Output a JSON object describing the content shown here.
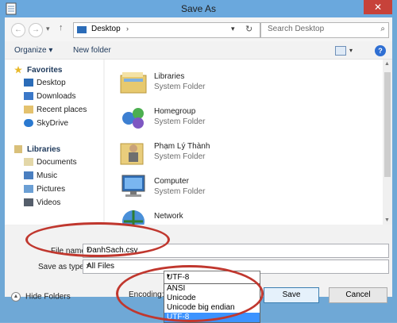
{
  "window": {
    "title": "Save As",
    "close_glyph": "✕"
  },
  "nav": {
    "back_glyph": "←",
    "forward_glyph": "→",
    "recent_glyph": "▾",
    "up_glyph": "↑",
    "address": "Desktop",
    "address_chevron": "›",
    "address_dropdown": "▾",
    "refresh_glyph": "↻",
    "search_placeholder": "Search Desktop",
    "search_glyph": "⌕"
  },
  "toolbar": {
    "organize": "Organize ▾",
    "new_folder": "New folder",
    "view_dropdown": "▾",
    "help": "?"
  },
  "sidebar": {
    "favorites": "Favorites",
    "favorites_items": [
      "Desktop",
      "Downloads",
      "Recent places",
      "SkyDrive"
    ],
    "libraries": "Libraries",
    "libraries_items": [
      "Documents",
      "Music",
      "Pictures",
      "Videos"
    ]
  },
  "files": [
    {
      "name": "Libraries",
      "type": "System Folder",
      "icon": "libraries-icon"
    },
    {
      "name": "Homegroup",
      "type": "System Folder",
      "icon": "homegroup-icon"
    },
    {
      "name": "Phạm Lý Thành",
      "type": "System Folder",
      "icon": "user-folder-icon"
    },
    {
      "name": "Computer",
      "type": "System Folder",
      "icon": "computer-icon"
    },
    {
      "name": "Network",
      "type": "",
      "icon": "network-icon"
    }
  ],
  "form": {
    "file_name_label": "File name:",
    "file_name_value": "DanhSach.csv",
    "save_type_label": "Save as type:",
    "save_type_value": "All Files",
    "encoding_label": "Encoding:",
    "encoding_value": "UTF-8",
    "encoding_options": [
      "ANSI",
      "Unicode",
      "Unicode big endian",
      "UTF-8"
    ],
    "hide_folders": "Hide Folders",
    "save": "Save",
    "cancel": "Cancel"
  },
  "colors": {
    "highlight": "#c0372e",
    "selected": "#3c93ff",
    "titlebar": "#6aa8dd"
  }
}
